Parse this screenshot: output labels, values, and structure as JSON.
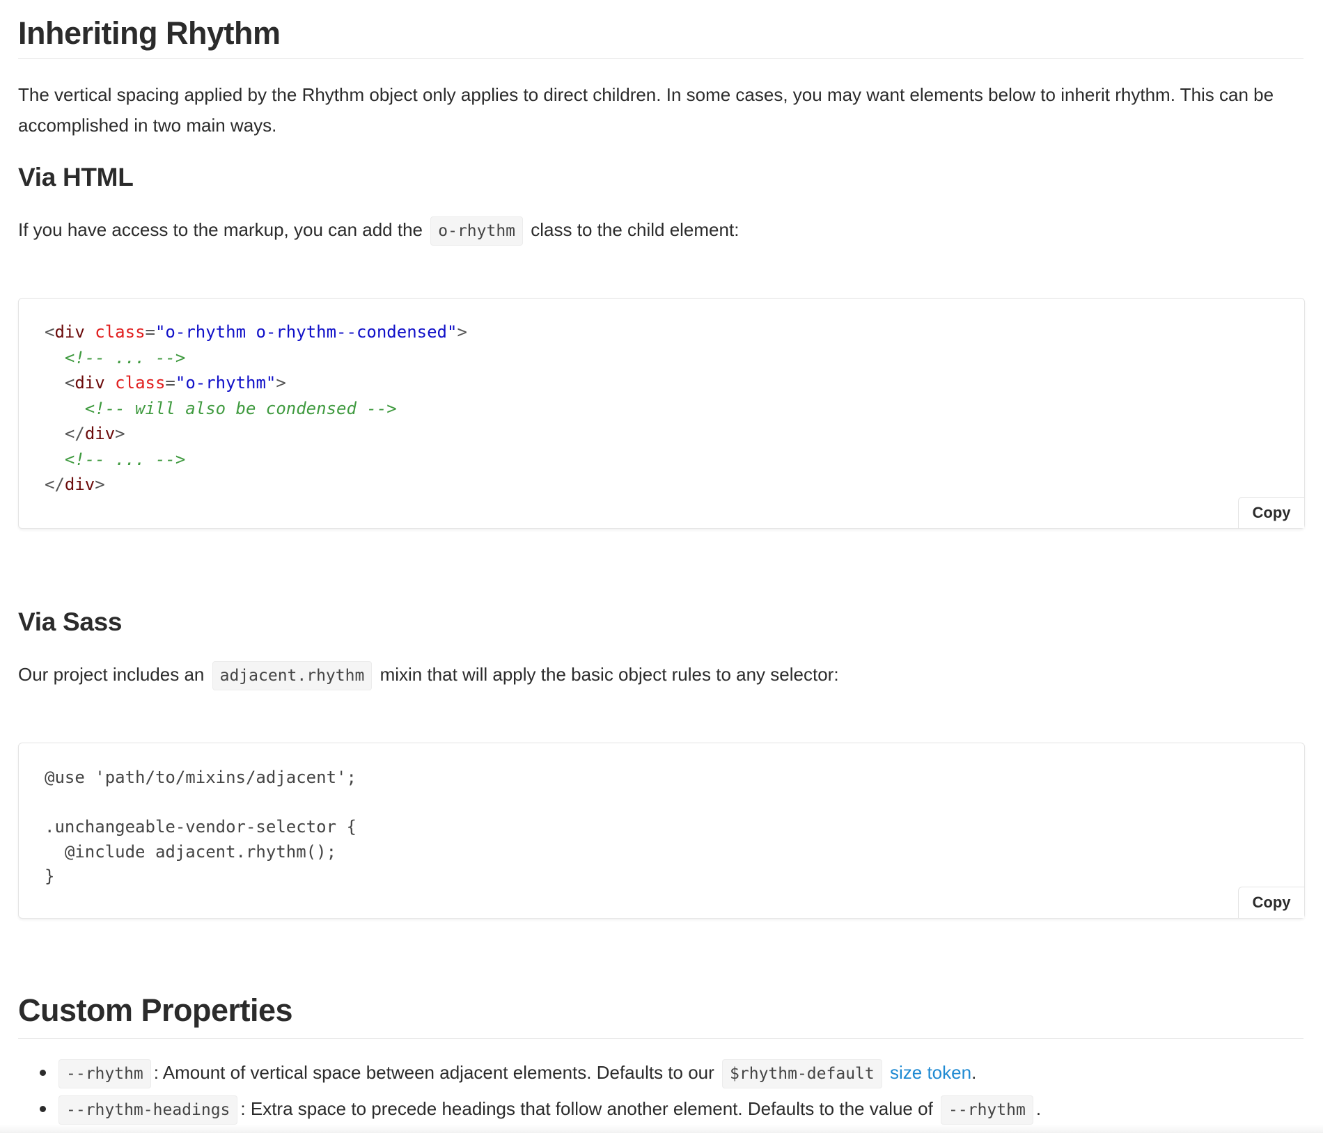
{
  "section1": {
    "title": "Inheriting Rhythm",
    "intro": "The vertical spacing applied by the Rhythm object only applies to direct children. In some cases, you may want elements below to inherit rhythm. This can be accomplished in two main ways."
  },
  "via_html": {
    "title": "Via HTML",
    "text_before": "If you have access to the markup, you can add the",
    "code": "o-rhythm",
    "text_after": "class to the child element:",
    "code_lines": [
      [
        "<",
        "div",
        " ",
        "class",
        "=",
        "\"o-rhythm o-rhythm--condensed\"",
        ">"
      ],
      [
        "<!-- ... -->"
      ],
      [
        "<",
        "div",
        " ",
        "class",
        "=",
        "\"o-rhythm\"",
        ">"
      ],
      [
        "<!-- will also be condensed -->"
      ],
      [
        "</",
        "div",
        ">"
      ],
      [
        "<!-- ... -->"
      ],
      [
        "</",
        "div",
        ">"
      ]
    ],
    "copy_label": "Copy"
  },
  "via_sass": {
    "title": "Via Sass",
    "text_before": "Our project includes an",
    "code": "adjacent.rhythm",
    "text_after": "mixin that will apply the basic object rules to any selector:",
    "code_lines": [
      "@use 'path/to/mixins/adjacent';",
      "",
      ".unchangeable-vendor-selector {",
      "  @include adjacent.rhythm();",
      "}"
    ],
    "copy_label": "Copy"
  },
  "custom_properties": {
    "title": "Custom Properties",
    "items": [
      {
        "code": "--rhythm",
        "text": ": Amount of vertical space between adjacent elements. Defaults to our",
        "code2": "$rhythm-default",
        "link": "size token",
        "end": "."
      },
      {
        "code": "--rhythm-headings",
        "text": ": Extra space to precede headings that follow another element. Defaults to the value of",
        "code2": "--rhythm",
        "end": "."
      }
    ]
  },
  "colors": {
    "tag": "#6b0b0b",
    "attr": "#e01e1e",
    "string": "#1010c8",
    "comment": "#3f9a3f",
    "link": "#1f8ad2"
  }
}
